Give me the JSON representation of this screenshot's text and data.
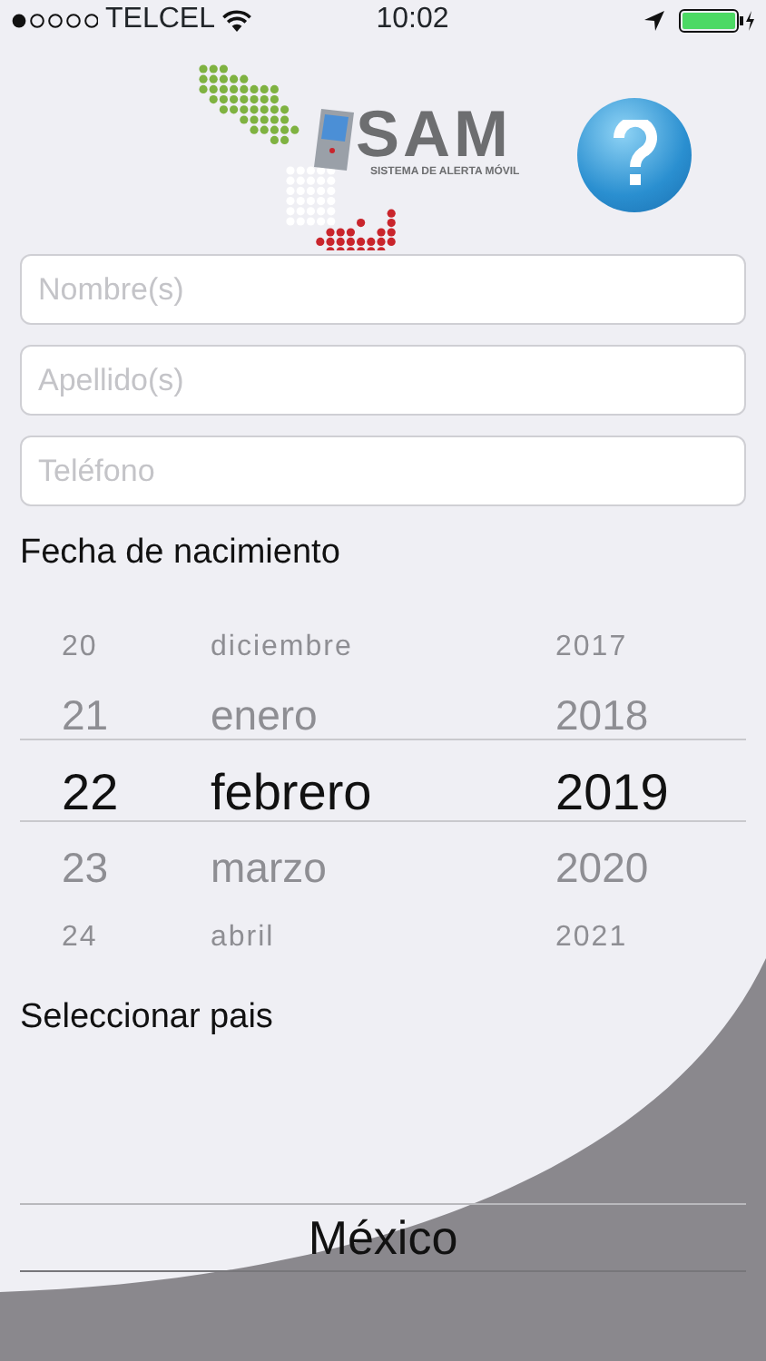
{
  "status_bar": {
    "carrier": "TELCEL",
    "time": "10:02"
  },
  "logo": {
    "title": "SAM",
    "subtitle": "SISTEMA DE ALERTA MÓVIL"
  },
  "fields": [
    {
      "placeholder": "Nombre(s)"
    },
    {
      "placeholder": "Apellido(s)"
    },
    {
      "placeholder": "Teléfono"
    }
  ],
  "birth_date": {
    "label": "Fecha de nacimiento",
    "columns": [
      {
        "items": [
          {
            "text": "20",
            "selected": false
          },
          {
            "text": "21",
            "selected": false
          },
          {
            "text": "22",
            "selected": true
          },
          {
            "text": "23",
            "selected": false
          },
          {
            "text": "24",
            "selected": false
          }
        ]
      },
      {
        "items": [
          {
            "text": "diciembre",
            "selected": false
          },
          {
            "text": "enero",
            "selected": false
          },
          {
            "text": "febrero",
            "selected": true
          },
          {
            "text": "marzo",
            "selected": false
          },
          {
            "text": "abril",
            "selected": false
          }
        ]
      },
      {
        "items": [
          {
            "text": "2017",
            "selected": false
          },
          {
            "text": "2018",
            "selected": false
          },
          {
            "text": "2019",
            "selected": true
          },
          {
            "text": "2020",
            "selected": false
          },
          {
            "text": "2021",
            "selected": false
          }
        ]
      }
    ]
  },
  "country": {
    "label": "Seleccionar pais",
    "items": [
      {
        "text": "México",
        "selected": true
      }
    ]
  }
}
